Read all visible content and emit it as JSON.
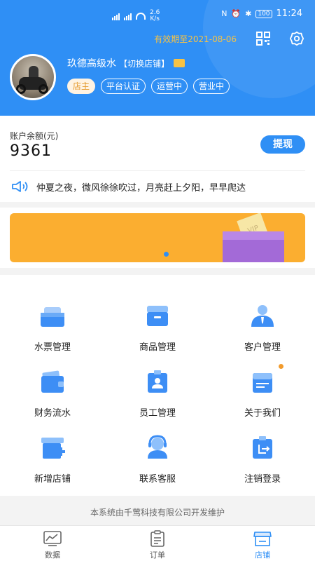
{
  "status_bar": {
    "net_speed": "2.6",
    "net_unit": "K/s",
    "battery": "100",
    "time": "11:24"
  },
  "header": {
    "expire_text": "有效期至2021-08-06",
    "store_name": "玖德高级水",
    "switch_label": "【切换店铺】",
    "tags": [
      "店主",
      "平台认证",
      "运营中",
      "营业中"
    ],
    "colors": {
      "primary": "#2f8ff5",
      "expire": "#f6c244",
      "owner_tag": "#e49a2d"
    }
  },
  "balance": {
    "label": "账户余额(元)",
    "value": "9361",
    "withdraw_label": "提现"
  },
  "notice": {
    "text": "仲夏之夜，微风徐徐吹过，月亮赶上夕阳，早早爬达"
  },
  "banner": {
    "card_text": "VIP"
  },
  "menu": [
    {
      "label": "水票管理",
      "icon": "water-ticket-icon"
    },
    {
      "label": "商品管理",
      "icon": "product-box-icon"
    },
    {
      "label": "客户管理",
      "icon": "customer-icon"
    },
    {
      "label": "财务流水",
      "icon": "wallet-icon"
    },
    {
      "label": "员工管理",
      "icon": "staff-badge-icon"
    },
    {
      "label": "关于我们",
      "icon": "about-icon"
    },
    {
      "label": "新增店铺",
      "icon": "add-store-icon"
    },
    {
      "label": "联系客服",
      "icon": "headset-icon"
    },
    {
      "label": "注销登录",
      "icon": "logout-icon"
    }
  ],
  "footer_note": "本系统由千莺科技有限公司开发维护",
  "tabbar": [
    {
      "label": "数据",
      "icon": "chart-icon",
      "active": false
    },
    {
      "label": "订单",
      "icon": "clipboard-icon",
      "active": false
    },
    {
      "label": "店铺",
      "icon": "store-icon",
      "active": true
    }
  ]
}
